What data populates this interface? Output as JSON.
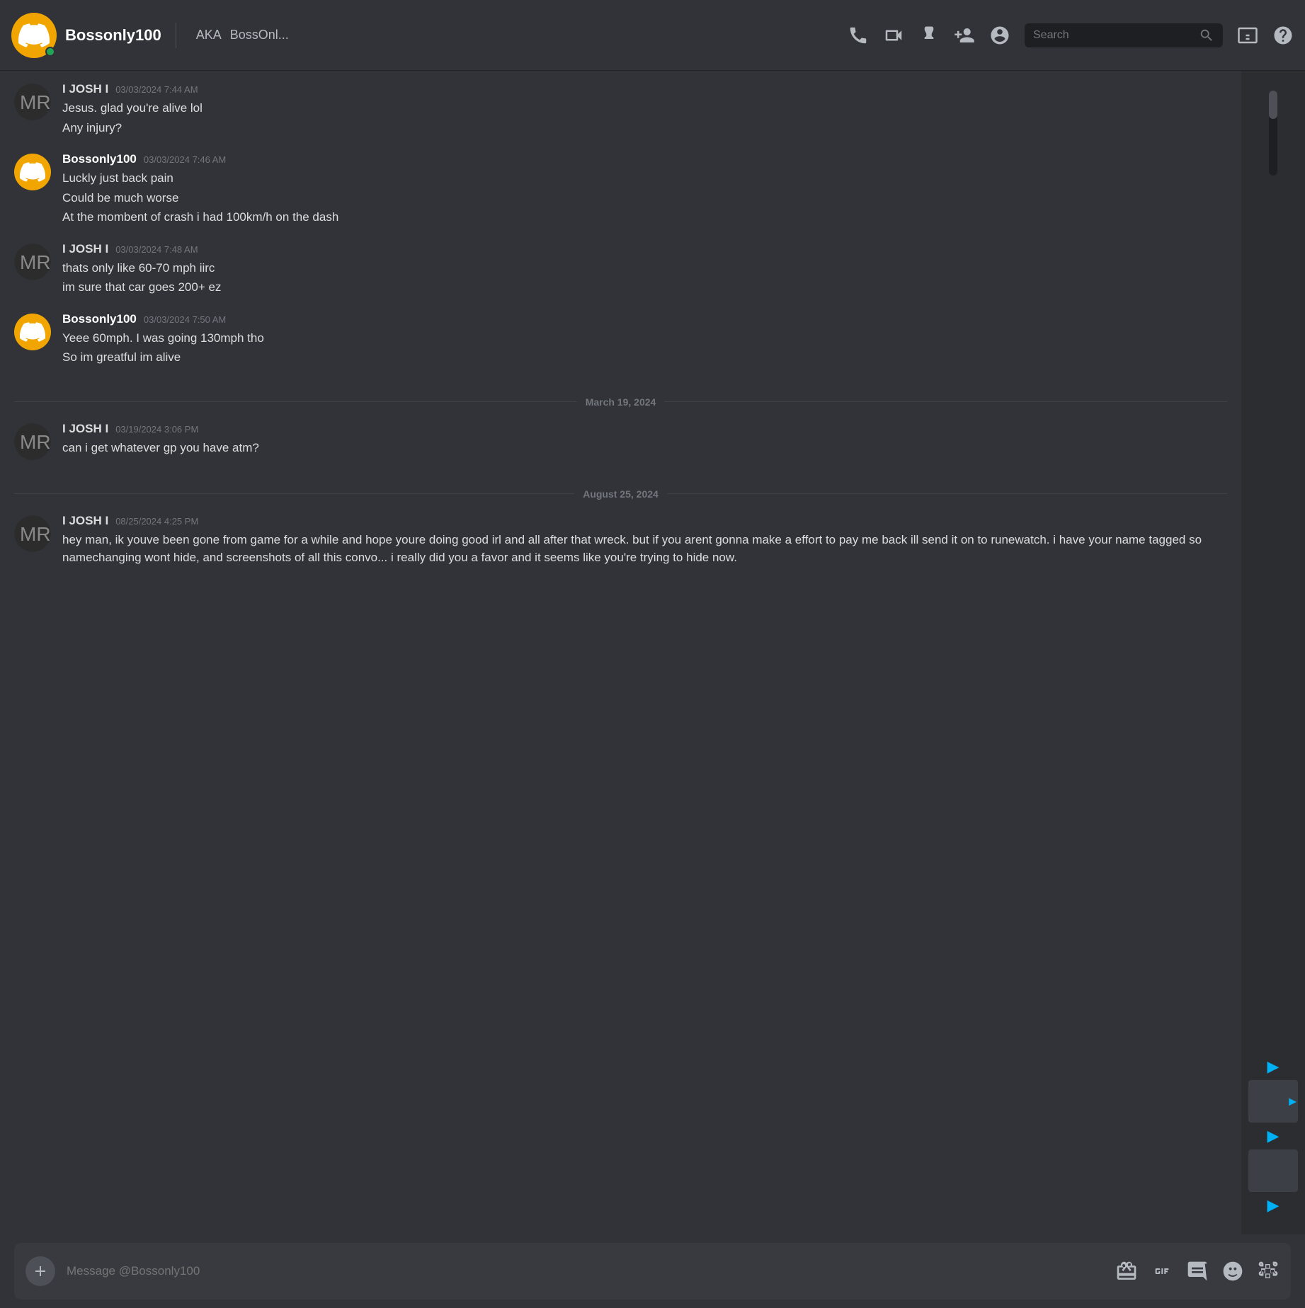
{
  "header": {
    "username": "Bossonly100",
    "aka_label": "AKA",
    "aka_name": "BossOnl...",
    "search_placeholder": "Search"
  },
  "messages": [
    {
      "id": "msg1",
      "author": "I JOSH I",
      "author_type": "josh",
      "timestamp": "03/03/2024 7:44 AM",
      "lines": [
        "Jesus. glad you're alive lol",
        "Any injury?"
      ]
    },
    {
      "id": "msg2",
      "author": "Bossonly100",
      "author_type": "bossonly",
      "timestamp": "03/03/2024 7:46 AM",
      "lines": [
        "Luckly just back pain",
        "Could be much worse",
        "At the mombent of crash i had 100km/h on the dash"
      ]
    },
    {
      "id": "msg3",
      "author": "I JOSH I",
      "author_type": "josh",
      "timestamp": "03/03/2024 7:48 AM",
      "lines": [
        "thats only like 60-70 mph iirc",
        "im sure that car goes 200+ ez"
      ]
    },
    {
      "id": "msg4",
      "author": "Bossonly100",
      "author_type": "bossonly",
      "timestamp": "03/03/2024 7:50 AM",
      "lines": [
        "Yeee 60mph. I was going 130mph  tho",
        "So im greatful im alive"
      ]
    }
  ],
  "date_dividers": [
    {
      "id": "div1",
      "text": "March 19, 2024",
      "after_msg": "msg4"
    },
    {
      "id": "div2",
      "text": "August 25, 2024",
      "after_msg": "msg5"
    }
  ],
  "messages2": [
    {
      "id": "msg5",
      "author": "I JOSH I",
      "author_type": "josh",
      "timestamp": "03/19/2024 3:06 PM",
      "lines": [
        "can i get whatever gp you have atm?"
      ]
    },
    {
      "id": "msg6",
      "author": "I JOSH I",
      "author_type": "josh",
      "timestamp": "08/25/2024 4:25 PM",
      "lines": [
        "hey man, ik youve been gone from game for a while and hope youre doing good irl and all after that wreck. but if you arent gonna make a effort to pay me back ill send it on to runewatch. i have your name tagged so namechanging wont hide, and screenshots of all this convo... i really did you a favor and it seems like you're trying to hide now."
      ]
    }
  ],
  "footer": {
    "placeholder": "Message @Bossonly100"
  }
}
